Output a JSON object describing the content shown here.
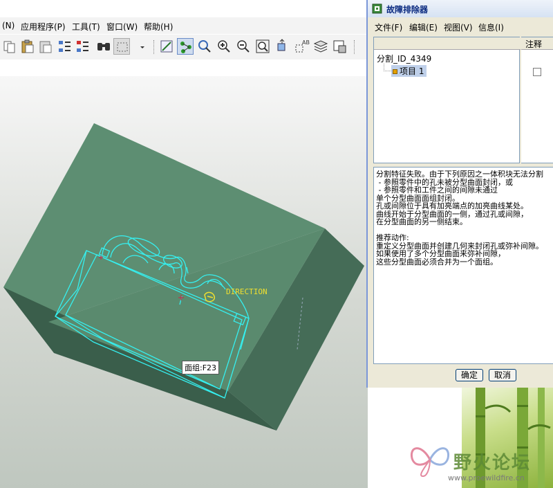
{
  "main_window": {
    "menu": [
      "(N)",
      "应用程序(P)",
      "工具(T)",
      "窗口(W)",
      "帮助(H)"
    ],
    "toolbar_icons": [
      "copy-icon",
      "paste-icon",
      "paste-special-icon",
      "regenerate-icon",
      "regenerate-manager-icon",
      "find-icon",
      "select-box-icon",
      "dropdown-arrow-icon",
      "spin-center-icon",
      "datum-icon",
      "orient-icon",
      "zoom-in-icon",
      "zoom-out-icon",
      "refit-icon",
      "reorient-icon",
      "annotation-icon",
      "layers-icon",
      "view-manager-icon"
    ],
    "model_label": "DIRECTION",
    "face_tooltip": "面组:F23"
  },
  "dialog": {
    "title": "故障排除器",
    "menu": [
      "文件(F)",
      "编辑(E)",
      "视图(V)",
      "信息(I)"
    ],
    "column_note": "注释",
    "tree_root": "分割_ID_4349",
    "tree_item": "项目 1",
    "message_lines": [
      "分割特征失败。由于下列原因之一体积块无法分割",
      " - 参照零件中的孔未被分型曲面封闭，或",
      " - 参照零件和工件之间的间隙未通过",
      "单个分型曲面面组封闭。",
      "孔或间隙位于具有加亮端点的加亮曲线某处。",
      "曲线开始于分型曲面的一侧，通过孔或间隙，",
      "在分型曲面的另一侧结束。",
      "",
      "推荐动作:",
      "重定义分型曲面并创建几何来封闭孔或弥补间隙。",
      "如果使用了多个分型曲面来弥补间隙，",
      "这些分型曲面必须合并为一个面组。"
    ],
    "ok_label": "确定",
    "cancel_label": "取消"
  },
  "watermark": {
    "text": "野火论坛",
    "url": "www.proewildfire.cn"
  },
  "colors": {
    "model_top": "#5d8e72",
    "model_side": "#456c57",
    "model_front": "#3a5e4b",
    "wire": "#35f0f0",
    "dialog_bg": "#ece9d8",
    "title_text": "#0a2a80"
  }
}
